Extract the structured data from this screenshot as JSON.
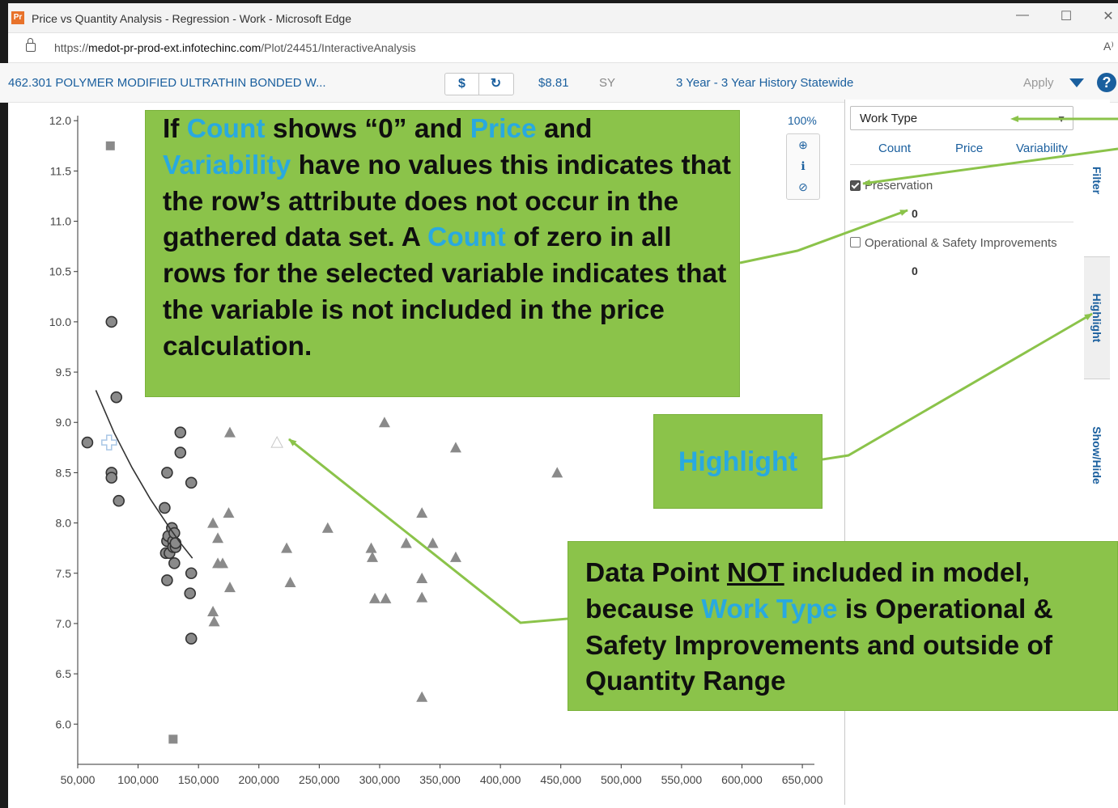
{
  "window": {
    "title": "Price vs Quantity Analysis - Regression - Work - Microsoft Edge",
    "app_icon_text": "Pr",
    "controls": {
      "minimize": "—",
      "maximize": "☐",
      "close": "✕"
    }
  },
  "address_bar": {
    "url_prefix": "https://",
    "url_host": "medot-pr-prod-ext.infotechinc.com",
    "url_path": "/Plot/24451/InteractiveAnalysis",
    "read_aloud": "A⁾"
  },
  "toolbar": {
    "item_title": "462.301 POLYMER MODIFIED ULTRATHIN BONDED W...",
    "dollar_label": "$",
    "refresh_label": "↻",
    "unit_price": "$8.81",
    "unit": "SY",
    "history": "3 Year - 3 Year History Statewide",
    "apply_label": "Apply",
    "help_label": "?"
  },
  "zoom": {
    "percent": "100%",
    "zoom_in": "⊕",
    "info": "ℹ",
    "reset": "⊘"
  },
  "filter_panel": {
    "selected": "Work Type",
    "columns": [
      "Count",
      "Price",
      "Variability"
    ],
    "rows": [
      {
        "label": "Preservation",
        "checked": true,
        "count": "0"
      },
      {
        "label": "Operational & Safety Improvements",
        "checked": false,
        "count": "0"
      }
    ]
  },
  "side_tabs": [
    "Filter",
    "Highlight",
    "Show/Hide"
  ],
  "callouts": {
    "count_note": {
      "p1": "If ",
      "k1": "Count",
      "p2": " shows “0” and ",
      "k2": "Price",
      "p3": " and",
      "k3": "Variability",
      "p4": " have no values this indicates that the row’s attribute does not occur in the gathered data set.  A ",
      "k4": "Count",
      "p5": " of zero in all rows for the selected variable indicates that the variable is not included in the price calculation."
    },
    "highlight_note": "Highlight",
    "datapoint_note": {
      "p1": "Data Point ",
      "u1": "NOT",
      "p2": " included in model, because ",
      "k1": "Work Type",
      "p3": " is Operational & Safety Improvements and outside of Quantity Range"
    }
  },
  "colors": {
    "link_blue": "#1a5f9e",
    "callout_green": "#8bc34a",
    "callout_keyword": "#29a9e0",
    "arrow_green": "#8bc34a"
  },
  "chart_data": {
    "type": "scatter",
    "title": "",
    "xlabel": "",
    "ylabel": "",
    "xlim": [
      50000,
      660000
    ],
    "ylim": [
      5.6,
      12.05
    ],
    "xticks": [
      50000,
      100000,
      150000,
      200000,
      250000,
      300000,
      350000,
      400000,
      450000,
      500000,
      550000,
      600000,
      650000
    ],
    "xtick_labels": [
      "50,000",
      "100,000",
      "150,000",
      "200,000",
      "250,000",
      "300,000",
      "350,000",
      "400,000",
      "450,000",
      "500,000",
      "550,000",
      "600,000",
      "650,000"
    ],
    "yticks": [
      6.0,
      6.5,
      7.0,
      7.5,
      8.0,
      8.5,
      9.0,
      9.5,
      10.0,
      10.5,
      11.0,
      11.5,
      12.0
    ],
    "ytick_labels": [
      "6.0",
      "6.5",
      "7.0",
      "7.5",
      "8.0",
      "8.5",
      "9.0",
      "9.5",
      "10.0",
      "10.5",
      "11.0",
      "11.5",
      "12.0"
    ],
    "series": [
      {
        "marker": "circle",
        "color": "#8a8a8a",
        "points": [
          [
            58000,
            8.8
          ],
          [
            78000,
            10.0
          ],
          [
            78000,
            8.5
          ],
          [
            78000,
            8.45
          ],
          [
            82000,
            9.25
          ],
          [
            84000,
            8.22
          ],
          [
            122000,
            8.15
          ],
          [
            123000,
            7.7
          ],
          [
            124000,
            7.82
          ],
          [
            124000,
            7.43
          ],
          [
            124000,
            8.5
          ],
          [
            125000,
            7.87
          ],
          [
            126000,
            7.7
          ],
          [
            128000,
            7.95
          ],
          [
            129000,
            7.82
          ],
          [
            129000,
            7.76
          ],
          [
            130000,
            7.9
          ],
          [
            130000,
            7.6
          ],
          [
            131000,
            7.76
          ],
          [
            131000,
            7.8
          ],
          [
            135000,
            8.9
          ],
          [
            135000,
            8.7
          ],
          [
            143000,
            7.3
          ],
          [
            144000,
            8.4
          ],
          [
            144000,
            7.5
          ],
          [
            144000,
            6.85
          ]
        ]
      },
      {
        "marker": "triangle",
        "color": "#8a8a8a",
        "points": [
          [
            162000,
            8.0
          ],
          [
            162000,
            7.12
          ],
          [
            163000,
            7.02
          ],
          [
            166000,
            7.85
          ],
          [
            166000,
            7.6
          ],
          [
            170000,
            7.6
          ],
          [
            175000,
            8.1
          ],
          [
            176000,
            8.9
          ],
          [
            176000,
            7.36
          ],
          [
            223000,
            7.75
          ],
          [
            226000,
            7.41
          ],
          [
            257000,
            7.95
          ],
          [
            293000,
            7.75
          ],
          [
            294000,
            7.66
          ],
          [
            296000,
            7.25
          ],
          [
            304000,
            9.0
          ],
          [
            305000,
            7.25
          ],
          [
            322000,
            7.8
          ],
          [
            335000,
            8.1
          ],
          [
            335000,
            7.45
          ],
          [
            335000,
            7.26
          ],
          [
            335000,
            6.27
          ],
          [
            344000,
            7.8
          ],
          [
            363000,
            8.75
          ],
          [
            363000,
            7.66
          ],
          [
            447000,
            8.5
          ]
        ]
      },
      {
        "marker": "square",
        "color": "#8a8a8a",
        "points": [
          [
            77000,
            11.75
          ],
          [
            129000,
            5.85
          ]
        ]
      },
      {
        "marker": "plus",
        "color": "#a9c7e6",
        "points": [
          [
            76000,
            8.8
          ]
        ]
      },
      {
        "marker": "triangle-outline",
        "color": "#c8c8c8",
        "points": [
          [
            215000,
            8.8
          ]
        ]
      }
    ],
    "regression_line": [
      [
        65000,
        9.32
      ],
      [
        80000,
        8.9
      ],
      [
        95000,
        8.55
      ],
      [
        110000,
        8.24
      ],
      [
        125000,
        7.97
      ],
      [
        135000,
        7.8
      ],
      [
        145000,
        7.65
      ]
    ]
  }
}
